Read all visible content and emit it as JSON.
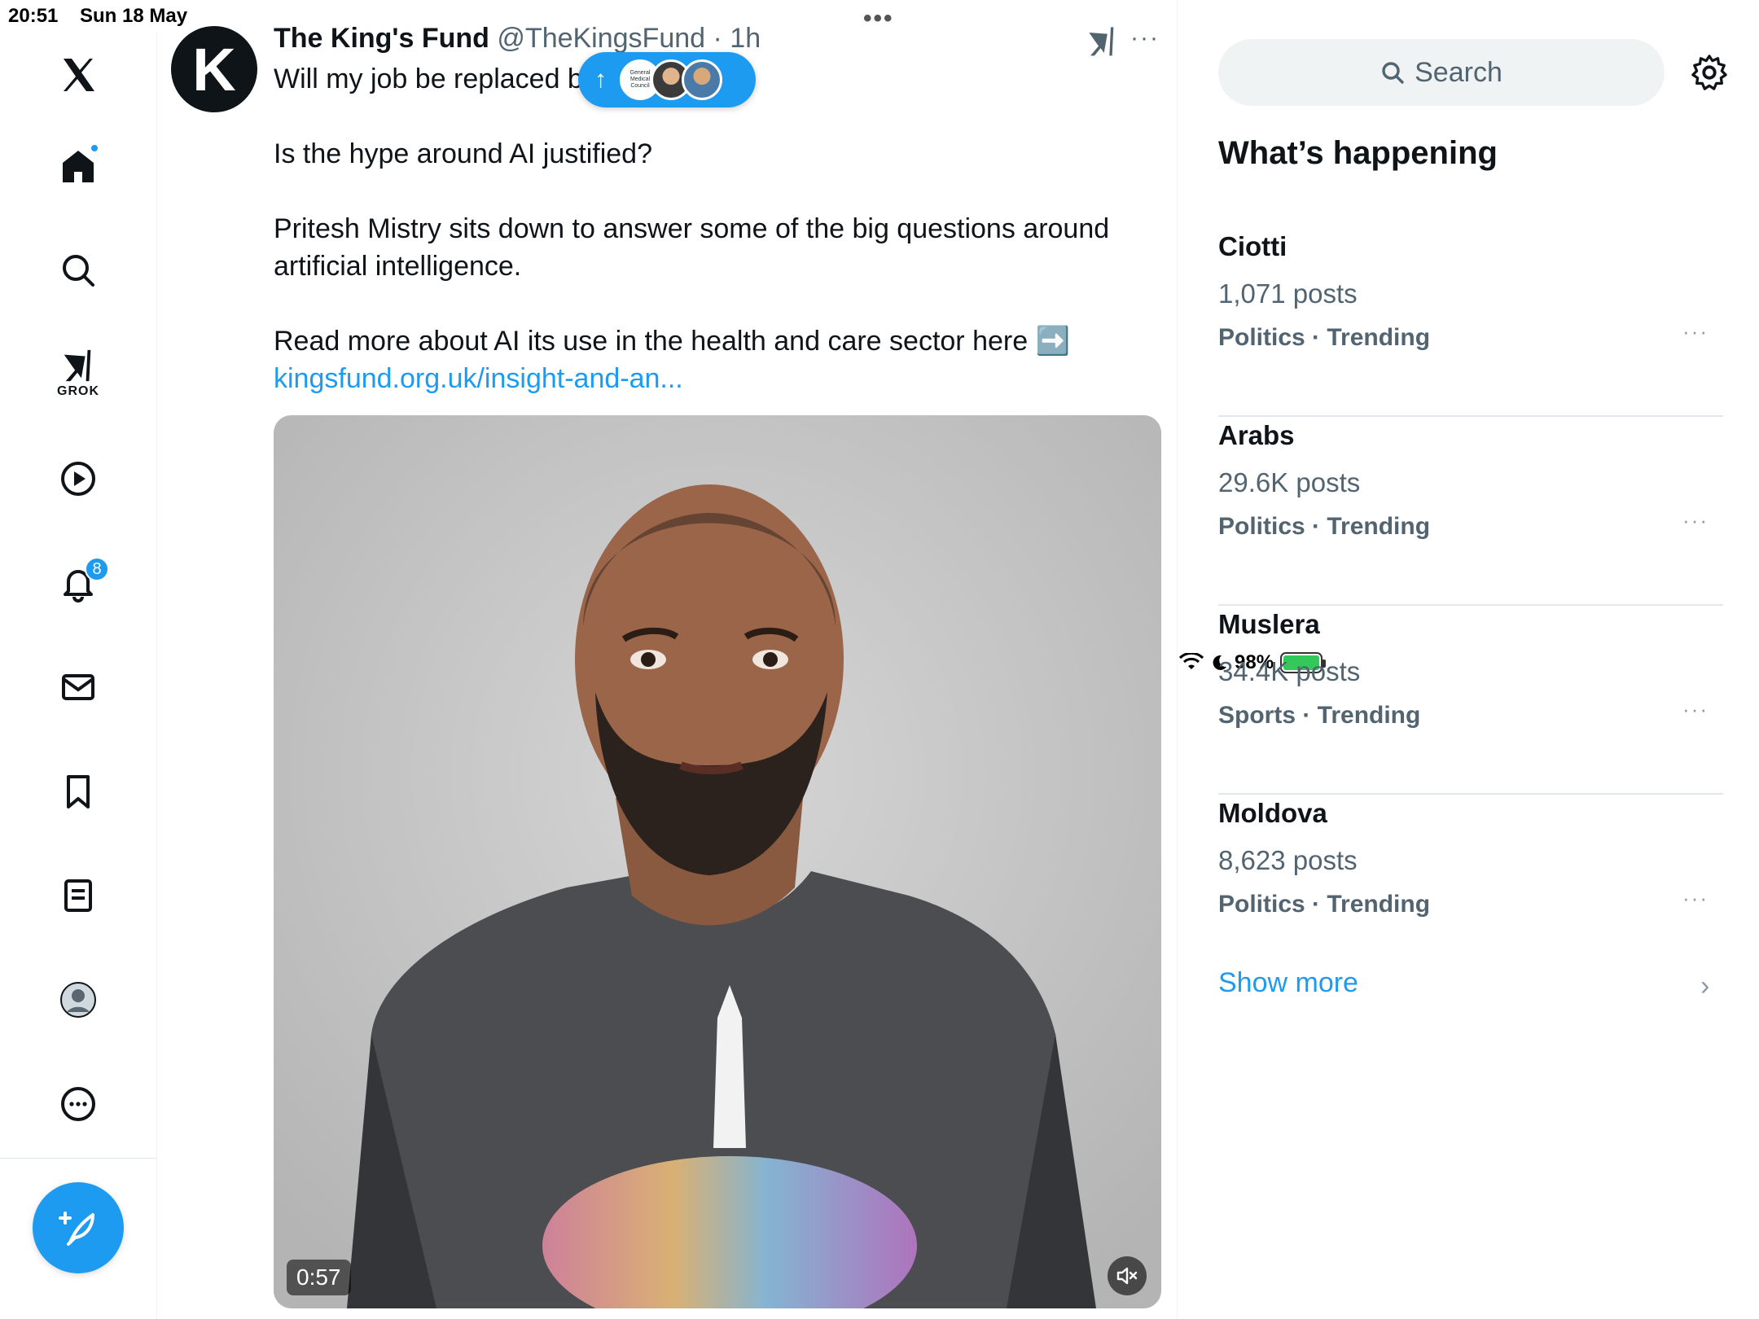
{
  "status_bar": {
    "time": "20:51",
    "date": "Sun 18 May",
    "battery": "98%",
    "multitask": "•••"
  },
  "nav": {
    "items": [
      {
        "name": "x-logo",
        "icon": "x-logo-icon"
      },
      {
        "name": "home",
        "icon": "home-icon",
        "has_dot": true
      },
      {
        "name": "explore",
        "icon": "search-icon"
      },
      {
        "name": "grok",
        "icon": "grok-icon",
        "label": "GROK"
      },
      {
        "name": "videos",
        "icon": "play-icon"
      },
      {
        "name": "notifications",
        "icon": "bell-icon",
        "badge": "8"
      },
      {
        "name": "messages",
        "icon": "mail-icon"
      },
      {
        "name": "bookmarks",
        "icon": "bookmark-icon"
      },
      {
        "name": "lists",
        "icon": "list-icon"
      },
      {
        "name": "profile",
        "icon": "avatar-icon"
      },
      {
        "name": "more",
        "icon": "more-circle-icon"
      }
    ],
    "accent": "#1d9bf0"
  },
  "post": {
    "avatar_letter": "K",
    "author_name": "The King's Fund",
    "author_handle": "@TheKingsFund",
    "time": "· 1h",
    "line1": "Will my job be replaced b",
    "line2": "Is the hype around AI justified?",
    "line3": "Pritesh Mistry sits down to answer some of the big questions around",
    "line4": "artificial intelligence.",
    "line5": "Read more about AI its use in the health and care sector here ➡️",
    "link": "kingsfund.org.uk/insight-and-an...",
    "more": "···",
    "video": {
      "duration": "0:57",
      "muted": true
    }
  },
  "new_posts_pill": {
    "arrow": "↑",
    "avatar1_text": "General Medical Council"
  },
  "sidebar": {
    "search_placeholder": "Search",
    "section_title": "What’s happening",
    "trends": [
      {
        "name": "Ciotti",
        "count": "1,071 posts",
        "meta": "Politics · Trending"
      },
      {
        "name": "Arabs",
        "count": "29.6K posts",
        "meta": "Politics · Trending"
      },
      {
        "name": "Muslera",
        "count": "34.4K posts",
        "meta": "Sports · Trending"
      },
      {
        "name": "Moldova",
        "count": "8,623 posts",
        "meta": "Politics · Trending"
      }
    ],
    "trend_more": "···",
    "show_more": "Show more",
    "chevron": "›"
  }
}
